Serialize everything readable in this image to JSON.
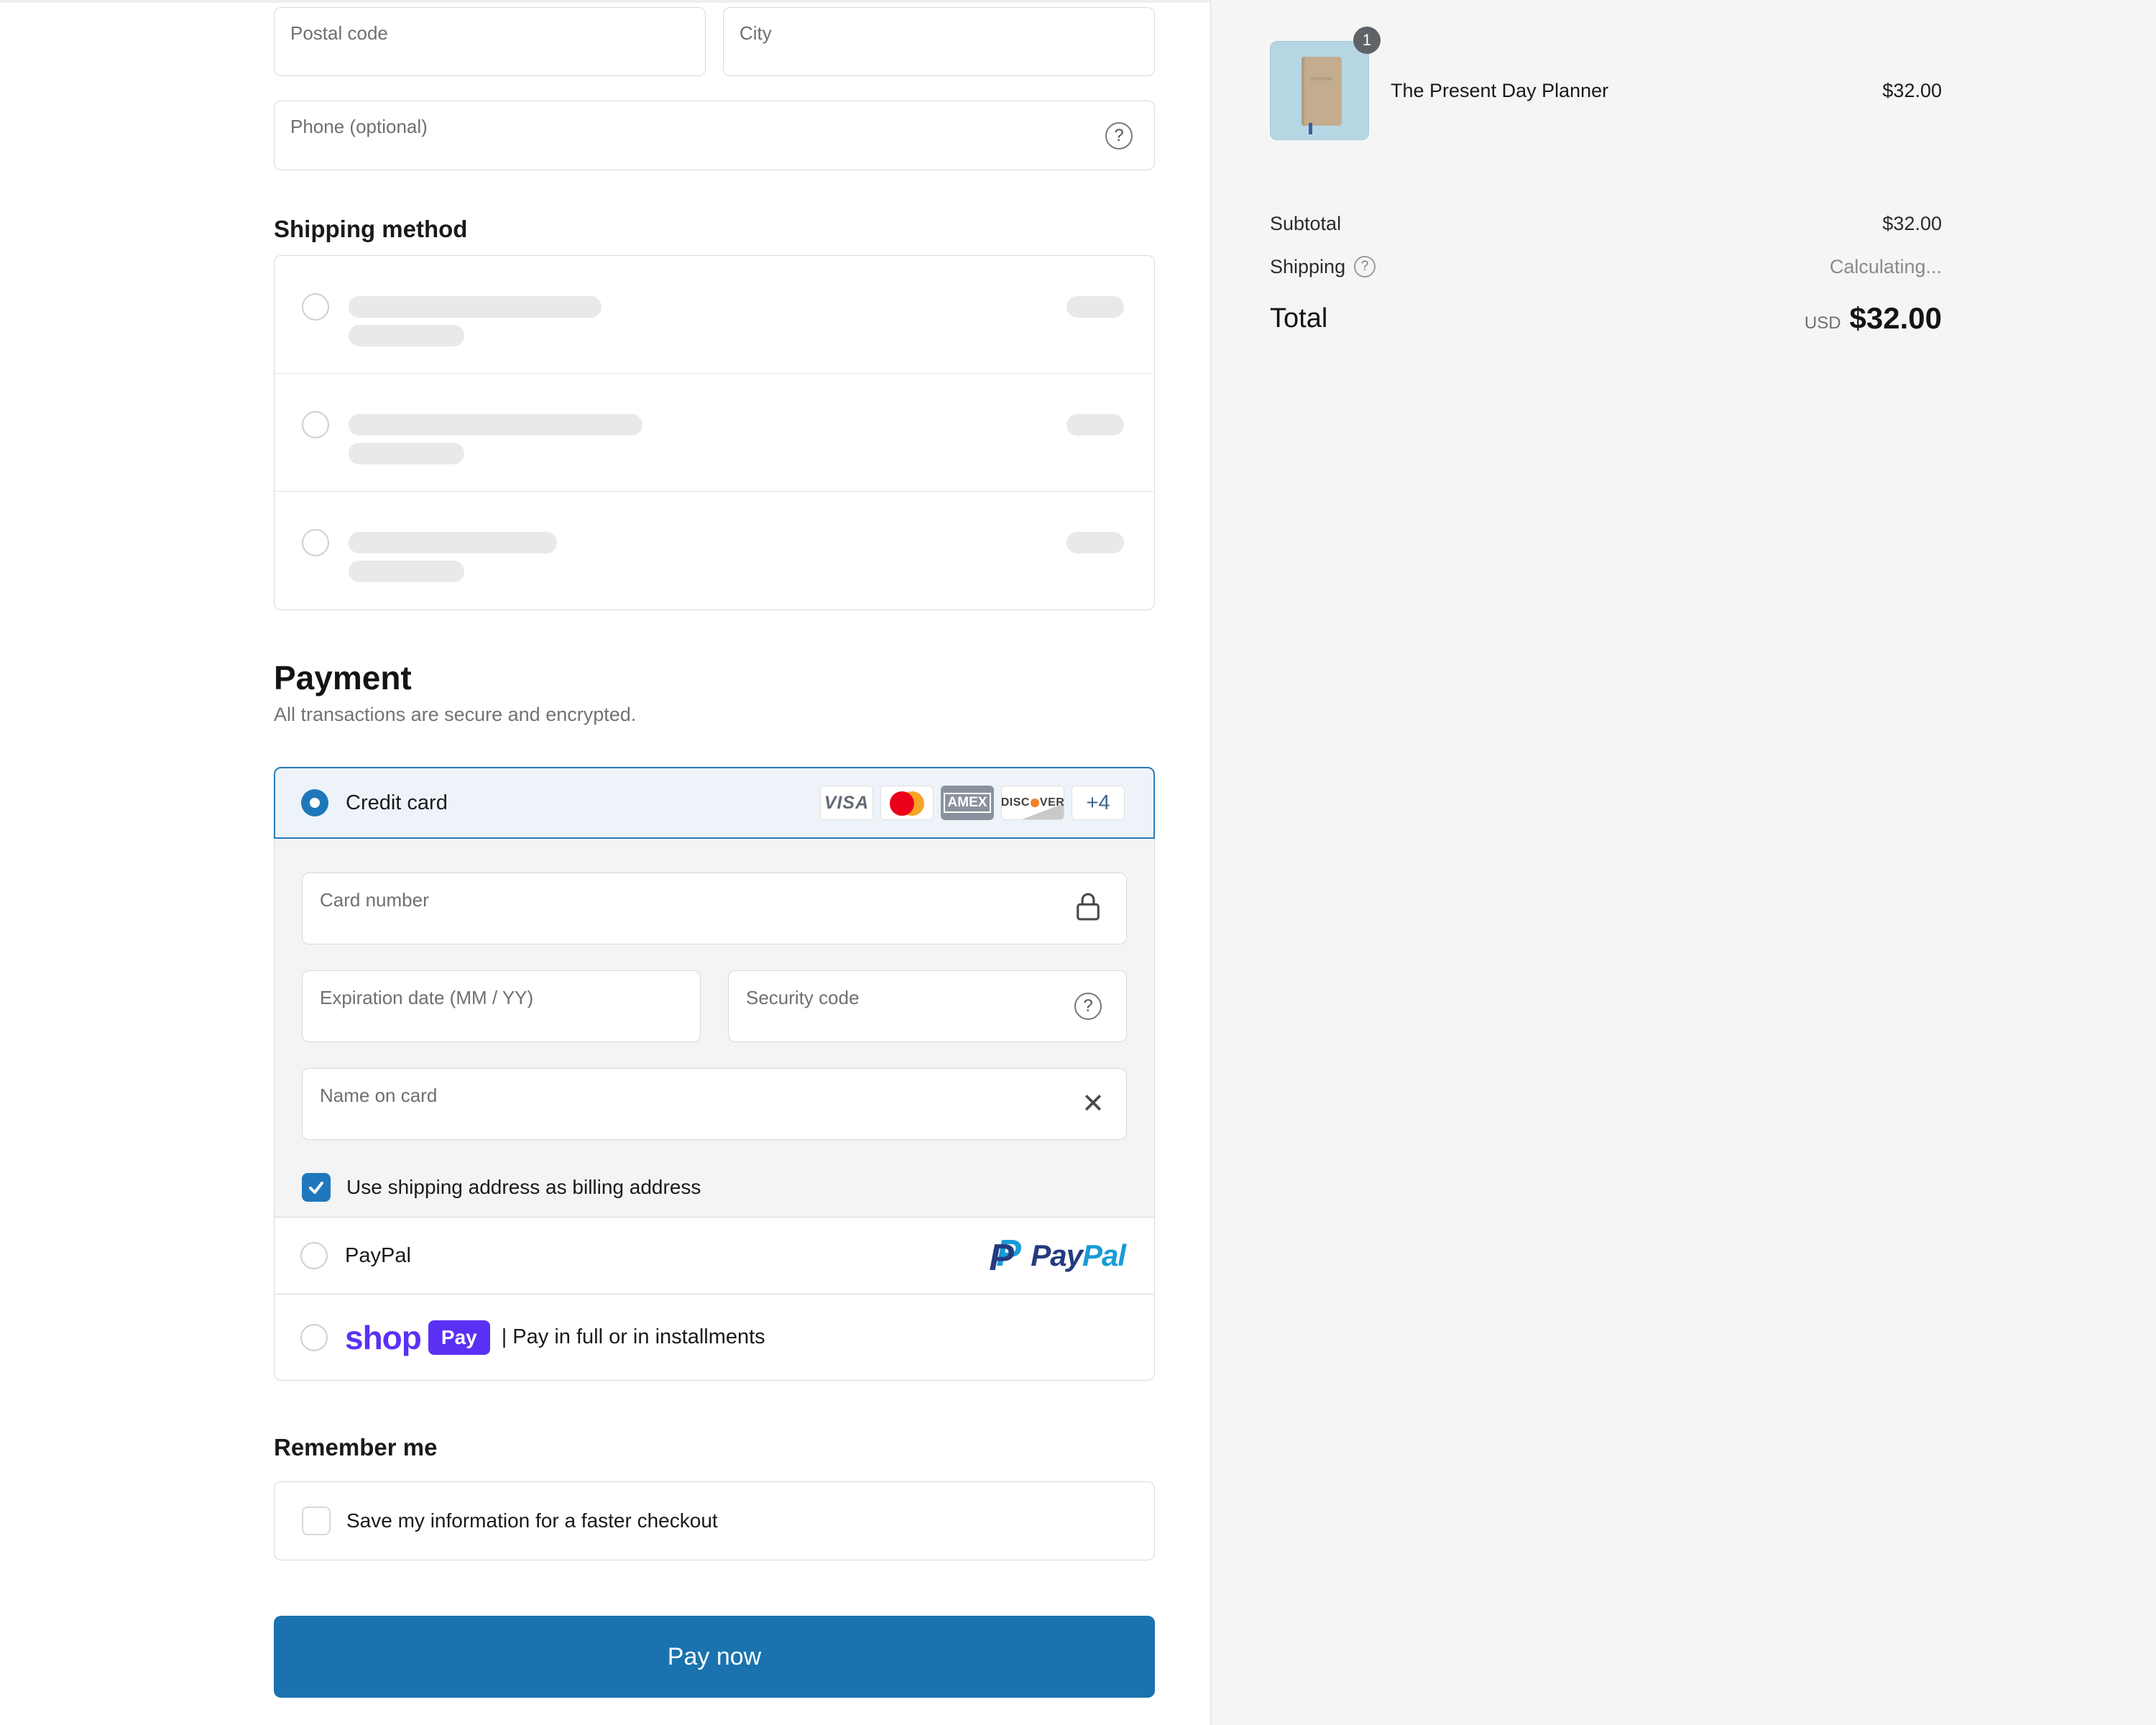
{
  "colors": {
    "accent_blue": "#1e77ba",
    "button_blue": "#1a73af",
    "selected_bg": "#eef3fa",
    "shop_purple": "#5a31f4",
    "paypal_dark": "#253b80",
    "paypal_light": "#179bd7",
    "mastercard_red": "#eb001b",
    "mastercard_orange": "#f79e1b",
    "thumb_bg": "#b7d6e4",
    "summary_bg": "#f5f5f5"
  },
  "icons": {
    "help": "?",
    "clear": "✕"
  },
  "address": {
    "postal_label": "Postal code",
    "city_label": "City",
    "phone_label": "Phone (optional)"
  },
  "shipping": {
    "title": "Shipping method"
  },
  "payment": {
    "title": "Payment",
    "subtitle": "All transactions are secure and encrypted.",
    "credit_card": {
      "label": "Credit card",
      "visa_text": "VISA",
      "amex_text": "AMEX",
      "discover_prefix": "DISC",
      "discover_suffix": "VER",
      "plus_badge": "+4"
    },
    "card_fields": {
      "number_label": "Card number",
      "expiry_label": "Expiration date (MM / YY)",
      "cvv_label": "Security code",
      "name_label": "Name on card",
      "billing_checkbox": "Use shipping address as billing address"
    },
    "paypal": {
      "label": "PayPal",
      "monogram": "P",
      "word_pay": "Pay",
      "word_pal": "Pal"
    },
    "shop_pay": {
      "wordmark": "shop",
      "badge": "Pay",
      "description": "| Pay in full or in installments"
    }
  },
  "remember": {
    "title": "Remember me",
    "save_label": "Save my information for a faster checkout"
  },
  "pay_button": "Pay now",
  "summary": {
    "product": {
      "quantity": "1",
      "name": "The Present Day Planner",
      "price": "$32.00"
    },
    "subtotal_label": "Subtotal",
    "subtotal_value": "$32.00",
    "shipping_label": "Shipping",
    "shipping_value": "Calculating...",
    "total_label": "Total",
    "currency": "USD",
    "total_value": "$32.00"
  }
}
